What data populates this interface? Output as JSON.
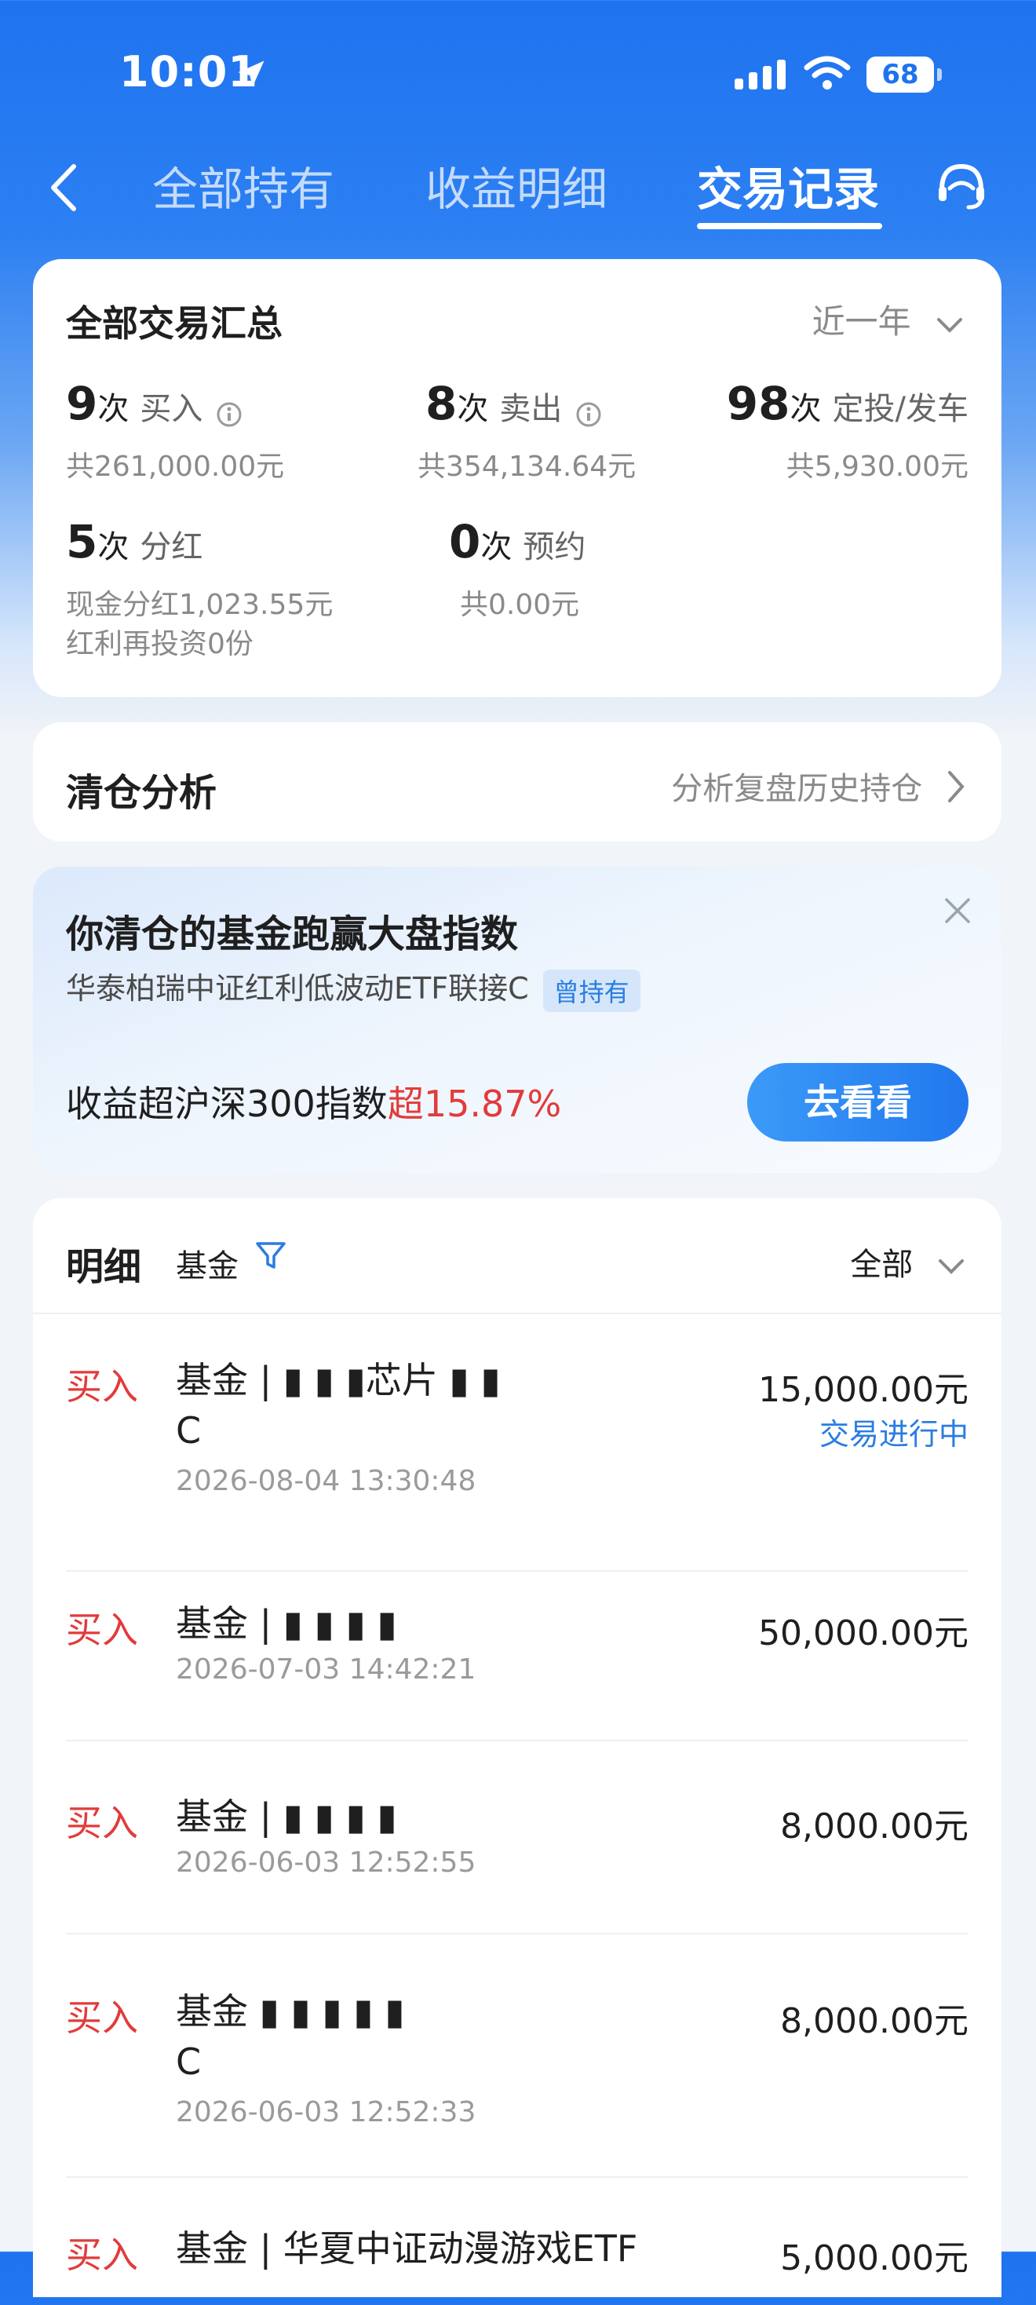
{
  "status": {
    "time": "10:01",
    "battery": "68"
  },
  "nav": {
    "tabs": [
      "全部持有",
      "收益明细",
      "交易记录"
    ],
    "active_tab": "交易记录"
  },
  "summary": {
    "title": "全部交易汇总",
    "range": "近一年",
    "stats": [
      {
        "count": "9",
        "unit": "次",
        "label": "买入",
        "sub": "共261,000.00元"
      },
      {
        "count": "8",
        "unit": "次",
        "label": "卖出",
        "sub": "共354,134.64元"
      },
      {
        "count": "98",
        "unit": "次",
        "label": "定投/发车",
        "sub": "共5,930.00元"
      },
      {
        "count": "5",
        "unit": "次",
        "label": "分红",
        "sub": "现金分红1,023.55元",
        "sub2": "红利再投资0份"
      },
      {
        "count": "0",
        "unit": "次",
        "label": "预约",
        "sub": "共0.00元"
      }
    ]
  },
  "clearance": {
    "title": "清仓分析",
    "link": "分析复盘历史持仓"
  },
  "promo": {
    "headline": "你清仓的基金跑赢大盘指数",
    "fund": "华泰柏瑞中证红利低波动ETF联接C",
    "tag": "曾持有",
    "perf_prefix": "收益超沪深300指数",
    "perf_value": "超15.87%",
    "button": "去看看"
  },
  "detail": {
    "title": "明细",
    "filter": "基金",
    "scope": "全部",
    "rows": [
      {
        "type": "买入",
        "name": "基金 | ▮ ▮ ▮芯片 ▮ ▮",
        "name2": "C",
        "date": "2026-08-04 13:30:48",
        "amount": "15,000.00元",
        "state": "交易进行中"
      },
      {
        "type": "买入",
        "name": "基金 | ▮ ▮ ▮ ▮",
        "date": "2026-07-03 14:42:21",
        "amount": "50,000.00元"
      },
      {
        "type": "买入",
        "name": "基金 | ▮ ▮ ▮ ▮",
        "date": "2026-06-03 12:52:55",
        "amount": "8,000.00元"
      },
      {
        "type": "买入",
        "name": "基金 ▮ ▮ ▮ ▮ ▮",
        "name2": "C",
        "date": "2026-06-03 12:52:33",
        "amount": "8,000.00元"
      },
      {
        "type": "买入",
        "name": "基金 | 华夏中证动漫游戏ETF",
        "amount": "5,000.00元"
      }
    ]
  }
}
